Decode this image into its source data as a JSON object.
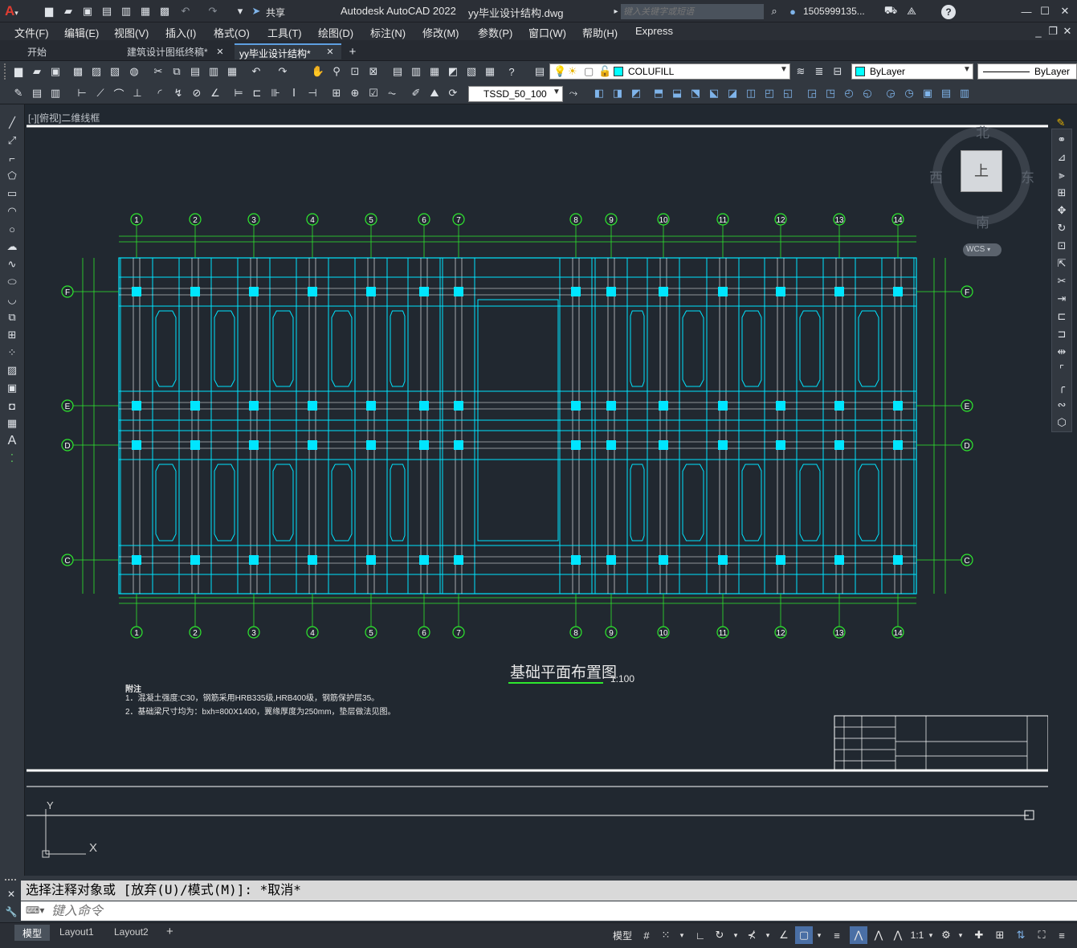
{
  "titlebar": {
    "app_title": "Autodesk AutoCAD 2022",
    "file_name": "yy毕业设计结构.dwg",
    "search_placeholder": "键入关键字或短语",
    "user": "1505999135...",
    "share_label": "共享",
    "help_label": "?"
  },
  "menu": [
    "文件(F)",
    "编辑(E)",
    "视图(V)",
    "插入(I)",
    "格式(O)",
    "工具(T)",
    "绘图(D)",
    "标注(N)",
    "修改(M)",
    "参数(P)",
    "窗口(W)",
    "帮助(H)",
    "Express"
  ],
  "tabs": {
    "start": "开始",
    "file1": "建筑设计图纸终稿*",
    "file2": "yy毕业设计结构*",
    "add": "+"
  },
  "toolbar": {
    "layer_name": "COLUFILL",
    "color_value": "ByLayer",
    "linetype_value": "ByLayer",
    "dimstyle_value": "TSSD_50_100"
  },
  "viewport": {
    "label": "[-][俯视]二维线框",
    "viewcube": {
      "north": "北",
      "south": "南",
      "east": "东",
      "west": "西",
      "top": "上",
      "wcs": "WCS"
    }
  },
  "drawing": {
    "title": "基础平面布置图",
    "scale": "1:100",
    "notes_title": "附注",
    "note1": "1．混凝土强度:C30，钢筋采用HRB335级,HRB400级，钢筋保护层35。",
    "note2": "2．基础梁尺寸均为：bxh=800X1400，翼缘厚度为250mm，垫层做法见图。",
    "axis_numbers": [
      "1",
      "2",
      "3",
      "4",
      "5",
      "6",
      "7",
      "8",
      "9",
      "10",
      "11",
      "12",
      "13",
      "14"
    ],
    "axis_letters": [
      "F",
      "E",
      "D",
      "C"
    ]
  },
  "ucs": {
    "y": "Y",
    "x": "X"
  },
  "command": {
    "history": "选择注释对象或 [放弃(U)/模式(M)]: *取消*",
    "placeholder": "键入命令"
  },
  "status": {
    "model_tab": "模型",
    "layout1": "Layout1",
    "layout2": "Layout2",
    "add": "+",
    "model_button": "模型",
    "scale": "1:1"
  }
}
